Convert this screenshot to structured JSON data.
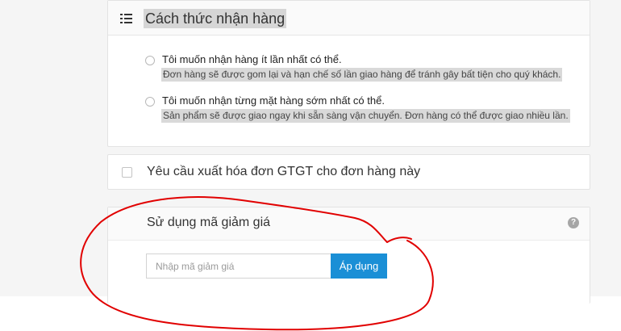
{
  "delivery": {
    "title": "Cách thức nhận hàng",
    "options": [
      {
        "title": "Tôi muốn nhận hàng ít lần nhất có thể.",
        "description": "Đơn hàng sẽ được gom lại và hạn chế số lần giao hàng để tránh gây bất tiện cho quý khách.",
        "selected": false
      },
      {
        "title": "Tôi muốn nhận từng mặt hàng sớm nhất có thể.",
        "description": "Sản phẩm sẽ được giao ngay khi sẵn sàng vận chuyển. Đơn hàng có thể được giao nhiều lần.",
        "selected": false
      }
    ]
  },
  "vat": {
    "label": "Yêu cầu xuất hóa đơn GTGT cho đơn hàng này",
    "checked": false
  },
  "coupon": {
    "title": "Sử dụng mã giảm giá",
    "help": "?",
    "placeholder": "Nhập mã giảm giá",
    "apply_label": "Áp dụng",
    "accent_color": "#1a8fd6"
  },
  "annotation": {
    "color": "#e10000",
    "shape": "hand-drawn circle around coupon section"
  }
}
